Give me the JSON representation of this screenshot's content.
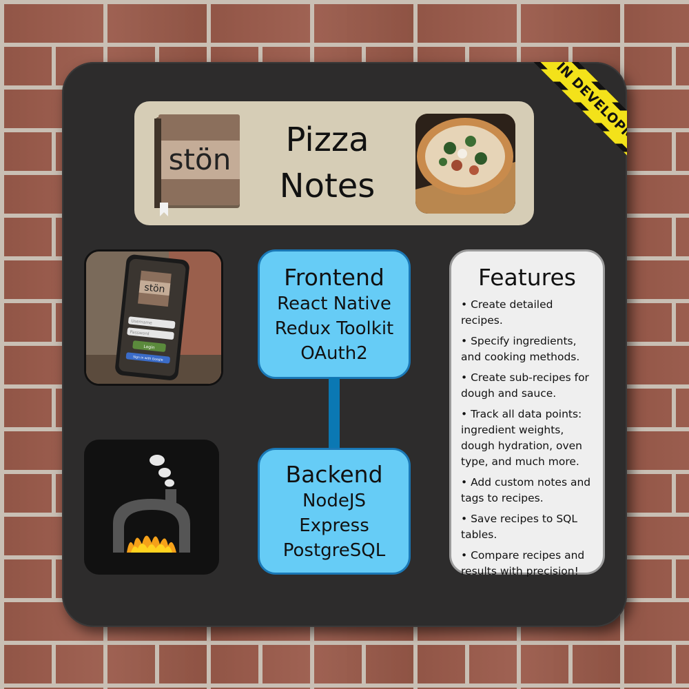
{
  "ribbon": {
    "text": "IN DEVELOPMENT"
  },
  "header": {
    "logo_text": "stön",
    "title_line1": "Pizza",
    "title_line2": "Notes"
  },
  "phone_mockup": {
    "logo_text": "stön",
    "username_placeholder": "Username",
    "password_placeholder": "Password",
    "login_label": "Login",
    "google_label": "Sign in with Google"
  },
  "frontend": {
    "title": "Frontend",
    "items": [
      "React Native",
      "Redux Toolkit",
      "OAuth2"
    ]
  },
  "backend": {
    "title": "Backend",
    "items": [
      "NodeJS",
      "Express",
      "PostgreSQL"
    ]
  },
  "features": {
    "title": "Features",
    "items": [
      "Create detailed recipes.",
      "Specify ingredients, and cooking methods.",
      "Create sub-recipes for dough and sauce.",
      "Track all data points: ingredient weights, dough hydration, oven type, and much more.",
      "Add custom notes and tags to recipes.",
      "Save recipes to SQL tables.",
      "Compare recipes and results with precision!"
    ]
  },
  "colors": {
    "board": "#2d2c2c",
    "header_card": "#d6cdb6",
    "stack_box": "#66ccf6",
    "stack_border": "#1a78b6",
    "tape_yellow": "#f3e21a"
  }
}
